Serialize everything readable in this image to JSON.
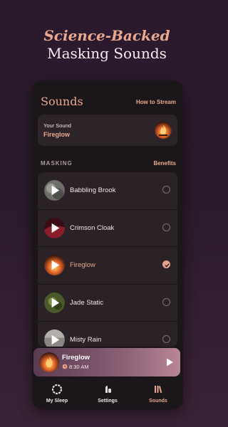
{
  "headline": {
    "line1": "Science-Backed",
    "line2": "Masking Sounds"
  },
  "sounds_screen": {
    "title": "Sounds",
    "how_to_stream": "How to Stream",
    "your_sound": {
      "label": "Your Sound",
      "value": "Fireglow",
      "icon": "fire-thumbnail"
    },
    "section": {
      "title": "MASKING",
      "benefits": "Benefits"
    },
    "items": [
      {
        "name": "Babbling Brook",
        "selected": false,
        "icon": "brook-thumbnail"
      },
      {
        "name": "Crimson Cloak",
        "selected": false,
        "icon": "crimson-thumbnail"
      },
      {
        "name": "Fireglow",
        "selected": true,
        "icon": "fire-thumbnail"
      },
      {
        "name": "Jade Static",
        "selected": false,
        "icon": "jade-thumbnail"
      },
      {
        "name": "Misty Rain",
        "selected": false,
        "icon": "rain-thumbnail"
      }
    ]
  },
  "mini_player": {
    "title": "Fireglow",
    "time": "8:30 AM"
  },
  "tabs": [
    {
      "label": "My Sleep",
      "icon": "sleep-ring-icon",
      "active": false
    },
    {
      "label": "Settings",
      "icon": "settings-icon",
      "active": false
    },
    {
      "label": "Sounds",
      "icon": "library-icon",
      "active": true
    }
  ],
  "colors": {
    "accent": "#e8a88e",
    "background_top": "#2b1a2e",
    "card": "#2a2226"
  }
}
